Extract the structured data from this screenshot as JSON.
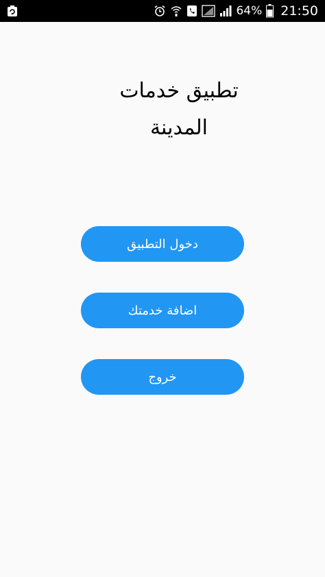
{
  "status_bar": {
    "battery_percent": "64%",
    "time": "21:50",
    "icons": [
      "notification-app-icon",
      "alarm-icon",
      "wifi-call-icon",
      "phone-icon",
      "no-signal-icon",
      "signal-icon",
      "battery-icon"
    ]
  },
  "main": {
    "title": "تطبيق خدمات المدينة",
    "buttons": {
      "enter_label": "دخول التطبيق",
      "add_service_label": "اضافة خدمتك",
      "exit_label": "خروج"
    }
  },
  "colors": {
    "button_background": "#2196f3",
    "screen_background": "#fafafa",
    "status_bar_background": "#000000"
  }
}
